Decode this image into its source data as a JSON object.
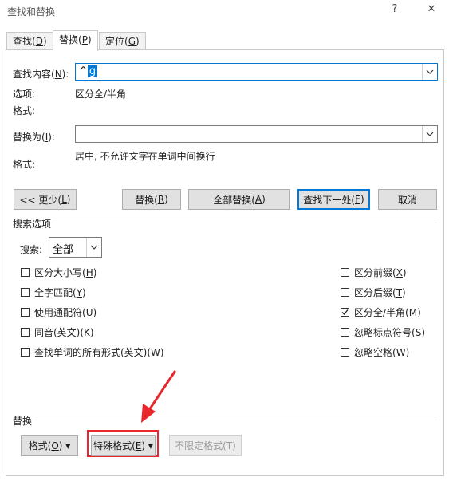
{
  "window": {
    "title": "查找和替换",
    "help": "?",
    "close": "✕"
  },
  "tabs": [
    {
      "label": "查找(",
      "key": "D",
      "end": ")"
    },
    {
      "label": "替换(",
      "key": "P",
      "end": ")"
    },
    {
      "label": "定位(",
      "key": "G",
      "end": ")"
    }
  ],
  "find": {
    "label": "查找内容(",
    "key": "N",
    "end": "):",
    "value_prefix": "^",
    "value_sel": "g"
  },
  "options": {
    "label": "选项:",
    "value": "区分全/半角"
  },
  "format1": {
    "label": "格式:"
  },
  "replace": {
    "label": "替换为(",
    "key": "I",
    "end": "):",
    "value": ""
  },
  "format2": {
    "label": "格式:",
    "value": "居中, 不允许文字在单词中间换行"
  },
  "buttons": {
    "less": {
      "label": "<< 更少(",
      "key": "L",
      "end": ")"
    },
    "replace": {
      "label": "替换(",
      "key": "R",
      "end": ")"
    },
    "replace_all": {
      "label": "全部替换(",
      "key": "A",
      "end": ")"
    },
    "find_next": {
      "label": "查找下一处(",
      "key": "F",
      "end": ")"
    },
    "cancel": {
      "label": "取消"
    }
  },
  "search_options": {
    "heading": "搜索选项",
    "search_label": "搜索",
    "search_key": "",
    "search_colon": ":",
    "search_value": "全部"
  },
  "checkboxes_left": [
    {
      "label": "区分大小写(",
      "key": "H",
      "end": ")",
      "checked": false
    },
    {
      "label": "全字匹配(",
      "key": "Y",
      "end": ")",
      "checked": false
    },
    {
      "label": "使用通配符(",
      "key": "U",
      "end": ")",
      "checked": false
    },
    {
      "label": "同音(英文)(",
      "key": "K",
      "end": ")",
      "checked": false
    },
    {
      "label": "查找单词的所有形式(英文)(",
      "key": "W",
      "end": ")",
      "checked": false
    }
  ],
  "checkboxes_right": [
    {
      "label": "区分前缀(",
      "key": "X",
      "end": ")",
      "checked": false
    },
    {
      "label": "区分后缀(",
      "key": "T",
      "end": ")",
      "checked": false
    },
    {
      "label": "区分全/半角(",
      "key": "M",
      "end": ")",
      "checked": true
    },
    {
      "label": "忽略标点符号(",
      "key": "S",
      "end": ")",
      "checked": false
    },
    {
      "label": "忽略空格(",
      "key": "W",
      "end": ")",
      "checked": false
    }
  ],
  "replace_section": {
    "heading": "替换",
    "format_btn": {
      "label": "格式(",
      "key": "O",
      "end": ") ▾"
    },
    "special_btn": {
      "label": "特殊格式(",
      "key": "E",
      "end": ") ▾"
    },
    "no_format_btn": {
      "label": "不限定格式(T)"
    }
  },
  "colors": {
    "accent": "#0078d7",
    "annotation": "#e8262b"
  }
}
